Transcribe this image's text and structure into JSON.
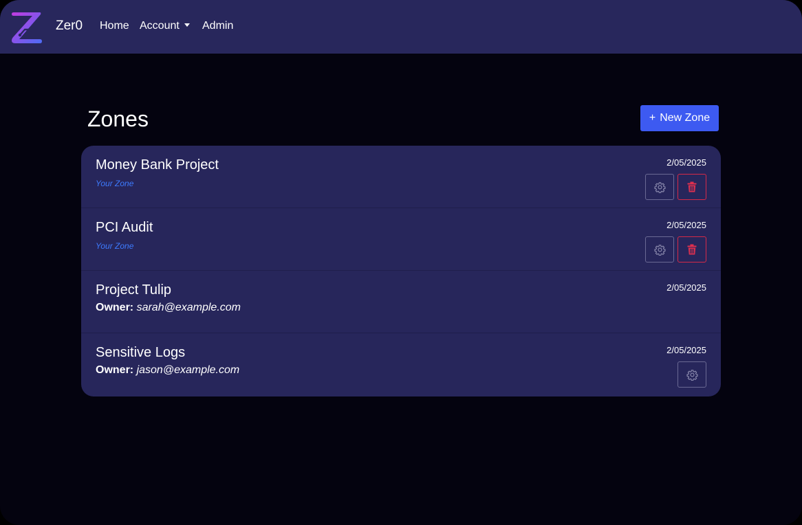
{
  "app": {
    "brand": "Zer0"
  },
  "nav": {
    "home": "Home",
    "account": "Account",
    "admin": "Admin"
  },
  "page": {
    "title": "Zones",
    "new_zone_label": "New Zone",
    "new_zone_prefix": "+"
  },
  "zones": [
    {
      "name": "Money Bank Project",
      "date": "2/05/2025",
      "tag": "Your Zone",
      "owner_label": "",
      "owner": "",
      "can_settings": true,
      "can_delete": true
    },
    {
      "name": "PCI Audit",
      "date": "2/05/2025",
      "tag": "Your Zone",
      "owner_label": "",
      "owner": "",
      "can_settings": true,
      "can_delete": true
    },
    {
      "name": "Project Tulip",
      "date": "2/05/2025",
      "tag": "",
      "owner_label": "Owner:",
      "owner": "sarah@example.com",
      "can_settings": false,
      "can_delete": false
    },
    {
      "name": "Sensitive Logs",
      "date": "2/05/2025",
      "tag": "",
      "owner_label": "Owner:",
      "owner": "jason@example.com",
      "can_settings": true,
      "can_delete": false
    }
  ],
  "colors": {
    "navbar": "#28275c",
    "background": "#04030f",
    "card": "#27265b",
    "accent": "#3d5af1",
    "your_zone": "#3d7bff",
    "danger": "#d72a48"
  },
  "icons": {
    "logo": "zer0-logo-icon",
    "caret": "caret-down-icon",
    "settings": "gear-icon",
    "delete": "trash-icon"
  }
}
